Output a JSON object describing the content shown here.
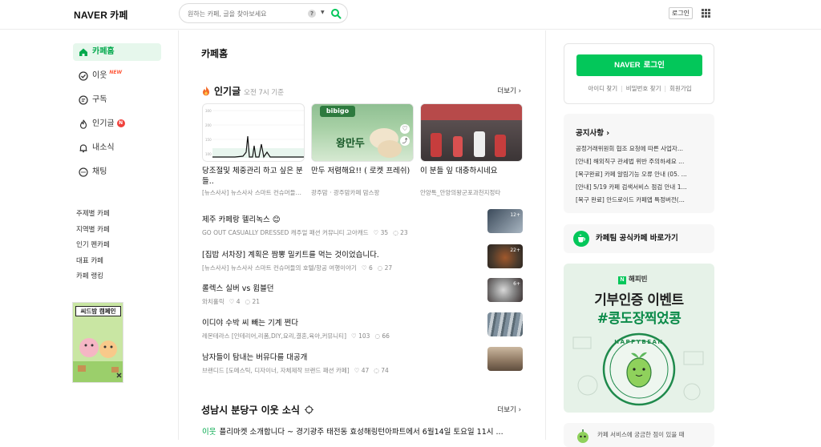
{
  "header": {
    "logo_main": "NAVER",
    "logo_sub": "카페",
    "search_placeholder": "원하는 카페, 글을 찾아보세요",
    "help_glyph": "?",
    "login_label": "로그인"
  },
  "sidebar": {
    "items": [
      {
        "label": "카페홈",
        "icon": "home-icon"
      },
      {
        "label": "이웃",
        "icon": "check-circle-icon",
        "badge": "NEW"
      },
      {
        "label": "구독",
        "icon": "document-icon"
      },
      {
        "label": "인기글",
        "icon": "flame-icon",
        "badge": "N"
      },
      {
        "label": "내소식",
        "icon": "bell-icon"
      },
      {
        "label": "채팅",
        "icon": "chat-icon"
      }
    ],
    "sub_items": [
      "주제별 카페",
      "지역별 카페",
      "인기 펜카페",
      "대표 카페",
      "카페 랭킹"
    ],
    "banner_text": "씨드밤 캠페인"
  },
  "main": {
    "title": "카페홈",
    "popular": {
      "title": "인기글",
      "subtitle": "오전 7시 기준",
      "more": "더보기",
      "cards": [
        {
          "title": "당조절및 체중관리 하고 싶은 분들..",
          "source": "[뉴스사사] 뉴스사사 스마트 컨슈머들의 호텔/항공 여행이야기"
        },
        {
          "title": "만두 저렴해요!! ( 로켓 프레쉬)",
          "source": "광주맘 · 광주맘카페 맘스팡",
          "thumb_text": "왕만두",
          "brand": "bibigo"
        },
        {
          "title": "이 분들 잎 대충하시네요",
          "source": "안양톡_안양의왕군포과천지정타"
        }
      ],
      "posts": [
        {
          "title": "제주 카페랑 헬리녹스 😊",
          "cafe": "GO OUT CASUALLY DRESSED 캐주얼 패션 커뮤니티 고아캐드",
          "likes": "35",
          "comments": "23",
          "img_badge": "12+"
        },
        {
          "title": "[집밥 서차장] 계획은 짬뽕 밀키트를 먹는 것이었습니다.",
          "cafe": "[뉴스사사] 뉴스사사 스마트 컨슈머들의 호텔/항공 여행이야기",
          "likes": "6",
          "comments": "27",
          "img_badge": "22+"
        },
        {
          "title": "롤렉스 실버 vs 윔블던",
          "cafe": "와치홀릭",
          "likes": "4",
          "comments": "21",
          "img_badge": "6+"
        },
        {
          "title": "이디야 수박 씨 빼는 기계 쩐다",
          "cafe": "레몬테라스 [인테리어,리폼,DIY,요리,결혼,육아,커뮤니티]",
          "likes": "103",
          "comments": "66",
          "img_badge": ""
        },
        {
          "title": "남자들이 탐내는 버뮤다를 대공개",
          "cafe": "브랜디드 [도메스틱, 디자이너, 자체제작 브랜드 패션 카페]",
          "likes": "47",
          "comments": "74",
          "img_badge": ""
        }
      ]
    },
    "neighbor": {
      "title": "성남시 분당구 이웃 소식",
      "more": "더보기",
      "first_tag": "이웃",
      "first_item": "플리마켓 소개합니다 ~ 경기광주 태전동 효성해링턴아파트에서 6월14일 토요일 11시 ..."
    }
  },
  "right": {
    "login_button_brand": "NAVER",
    "login_button_label": "로그인",
    "links": [
      "아이디 찾기",
      "비밀번호 찾기",
      "회원가입"
    ],
    "notice": {
      "title": "공지사항",
      "items": [
        "공정거래위원회 협조 요청에 따른 사업자...",
        "[안내] 해외직구 관세법 위반 주의하세요 ...",
        "[복구완료] 카페 알림기능 오류 안내 (05. ...",
        "[안내] 5/19 카페 검색서비스 점검 안내 1...",
        "[복구 완료] 안드로이드 카페앱 특정버전(..."
      ]
    },
    "official_link": "카페팀 공식카페 바로가기",
    "event": {
      "brand": "해피빈",
      "line1": "기부인증 이벤트",
      "line2": "#콩도장찍었콩",
      "stamp_text": "HAPPYBEAN"
    },
    "help_text": "카페 서비스에 궁금한 점이 있을 때"
  }
}
